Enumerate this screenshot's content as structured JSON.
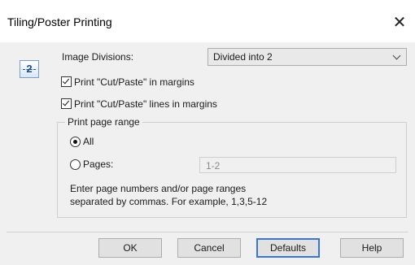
{
  "window": {
    "title": "Tiling/Poster Printing"
  },
  "preview": {
    "number": "2"
  },
  "image_divisions": {
    "label": "Image Divisions:",
    "selected": "Divided into 2"
  },
  "checkboxes": {
    "cut_paste_margins": {
      "label": "Print \"Cut/Paste\" in margins",
      "checked": true
    },
    "cut_paste_lines": {
      "label": "Print \"Cut/Paste\" lines in margins",
      "checked": true
    }
  },
  "page_range": {
    "legend": "Print page range",
    "all_label": "All",
    "pages_label": "Pages:",
    "pages_value": "1-2",
    "selected": "all",
    "help": "Enter page numbers and/or page ranges\nseparated by commas. For example, 1,3,5-12"
  },
  "buttons": {
    "ok": "OK",
    "cancel": "Cancel",
    "defaults": "Defaults",
    "help": "Help"
  }
}
